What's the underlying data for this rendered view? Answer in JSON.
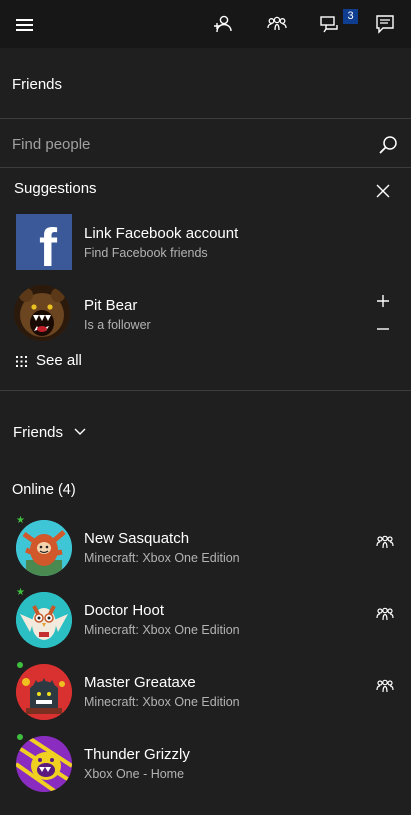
{
  "topbar": {
    "menu_icon": "hamburger-icon",
    "icons": [
      "find-friend-icon",
      "party-icon",
      "messages-icon",
      "activity-feed-icon"
    ],
    "messages_badge": "3"
  },
  "header": {
    "title": "Friends"
  },
  "search": {
    "placeholder": "Find people",
    "icon": "search-icon"
  },
  "suggestions": {
    "title": "Suggestions",
    "items": [
      {
        "title": "Link Facebook account",
        "subtitle": "Find Facebook friends",
        "icon": "facebook-icon"
      },
      {
        "title": "Pit Bear",
        "subtitle": "Is a follower"
      }
    ],
    "see_all": "See all"
  },
  "friends_filter": {
    "label": "Friends"
  },
  "online": {
    "header": "Online (4)",
    "friends": [
      {
        "name": "New Sasquatch",
        "status": "Minecraft: Xbox One Edition",
        "presence": "star"
      },
      {
        "name": "Doctor Hoot",
        "status": "Minecraft: Xbox One Edition",
        "presence": "star"
      },
      {
        "name": "Master Greataxe",
        "status": "Minecraft: Xbox One Edition",
        "presence": "dot"
      },
      {
        "name": "Thunder Grizzly",
        "status": "Xbox One - Home",
        "presence": "dot"
      }
    ]
  },
  "colors": {
    "accent_badge": "#0f3e91",
    "online_green": "#3fbf3f",
    "facebook_blue": "#3b5998"
  }
}
